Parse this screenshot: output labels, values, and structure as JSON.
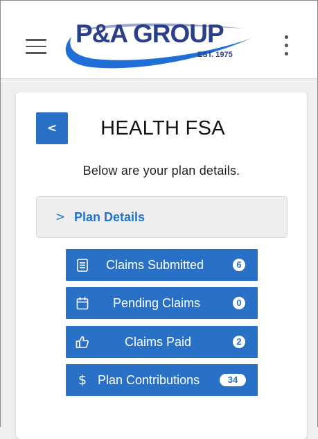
{
  "header": {
    "logo_text": "P&A GROUP",
    "logo_est": "EST. 1975",
    "colors": {
      "logo_text": "#2a3f88",
      "logo_swoosh": "#1f6fd6"
    }
  },
  "main": {
    "back_label": "<",
    "title": "HEALTH FSA",
    "subtitle": "Below are your plan details.",
    "plan_details": {
      "chevron": ">",
      "label": "Plan Details"
    },
    "actions": [
      {
        "label": "Claims Submitted",
        "count": "6",
        "icon": "receipt-icon"
      },
      {
        "label": "Pending Claims",
        "count": "0",
        "icon": "calendar-icon"
      },
      {
        "label": "Claims Paid",
        "count": "2",
        "icon": "thumbs-up-icon"
      },
      {
        "label": "Plan Contributions",
        "count": "34",
        "icon": "dollar-icon"
      }
    ]
  },
  "colors": {
    "accent": "#2971c6",
    "link": "#1f73d2",
    "background": "#efefef",
    "card": "#ffffff"
  }
}
